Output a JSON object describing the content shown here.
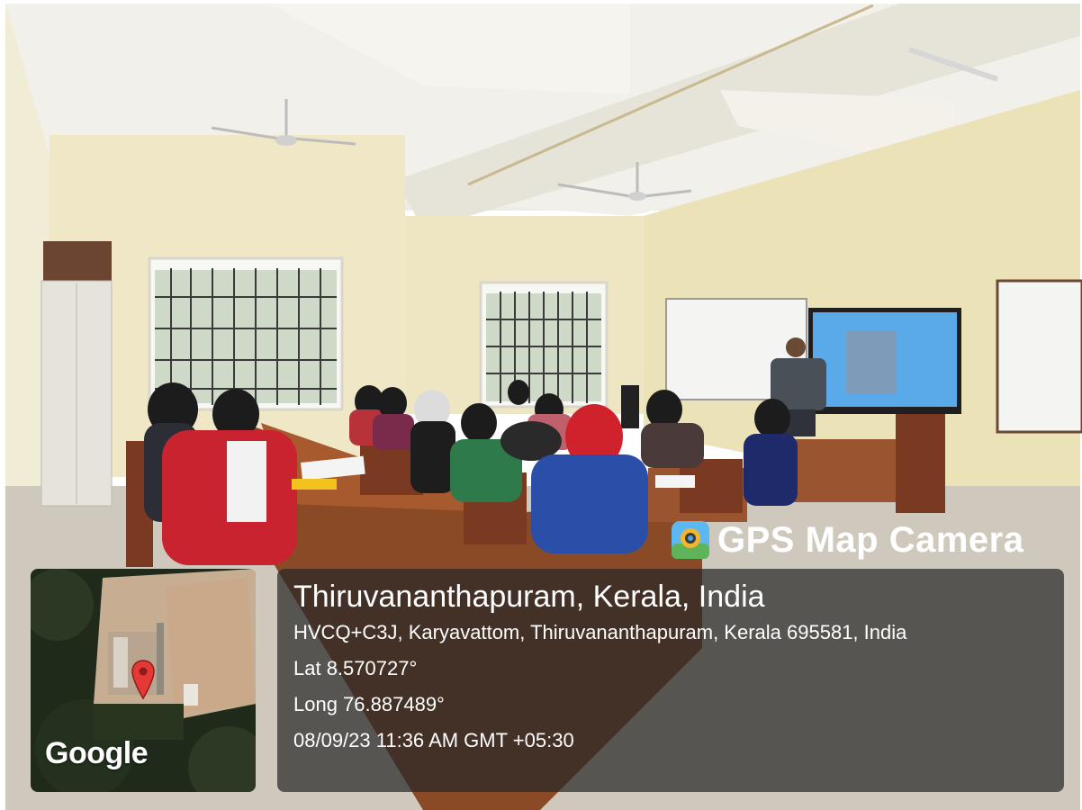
{
  "overlay": {
    "app_title": "GPS Map Camera",
    "place": "Thiruvananthapuram, Kerala, India",
    "address": "HVCQ+C3J, Karyavattom, Thiruvananthapuram, Kerala 695581, India",
    "latitude": "Lat 8.570727°",
    "longitude": "Long 76.887489°",
    "datetime": "08/09/23 11:36 AM GMT +05:30",
    "map_logo": "Google",
    "icons": [
      "gps-map-camera-app-icon",
      "map-pin-icon"
    ]
  },
  "colors": {
    "panel_bg": "#282828",
    "text": "#ffffff",
    "pin": "#e53935"
  }
}
